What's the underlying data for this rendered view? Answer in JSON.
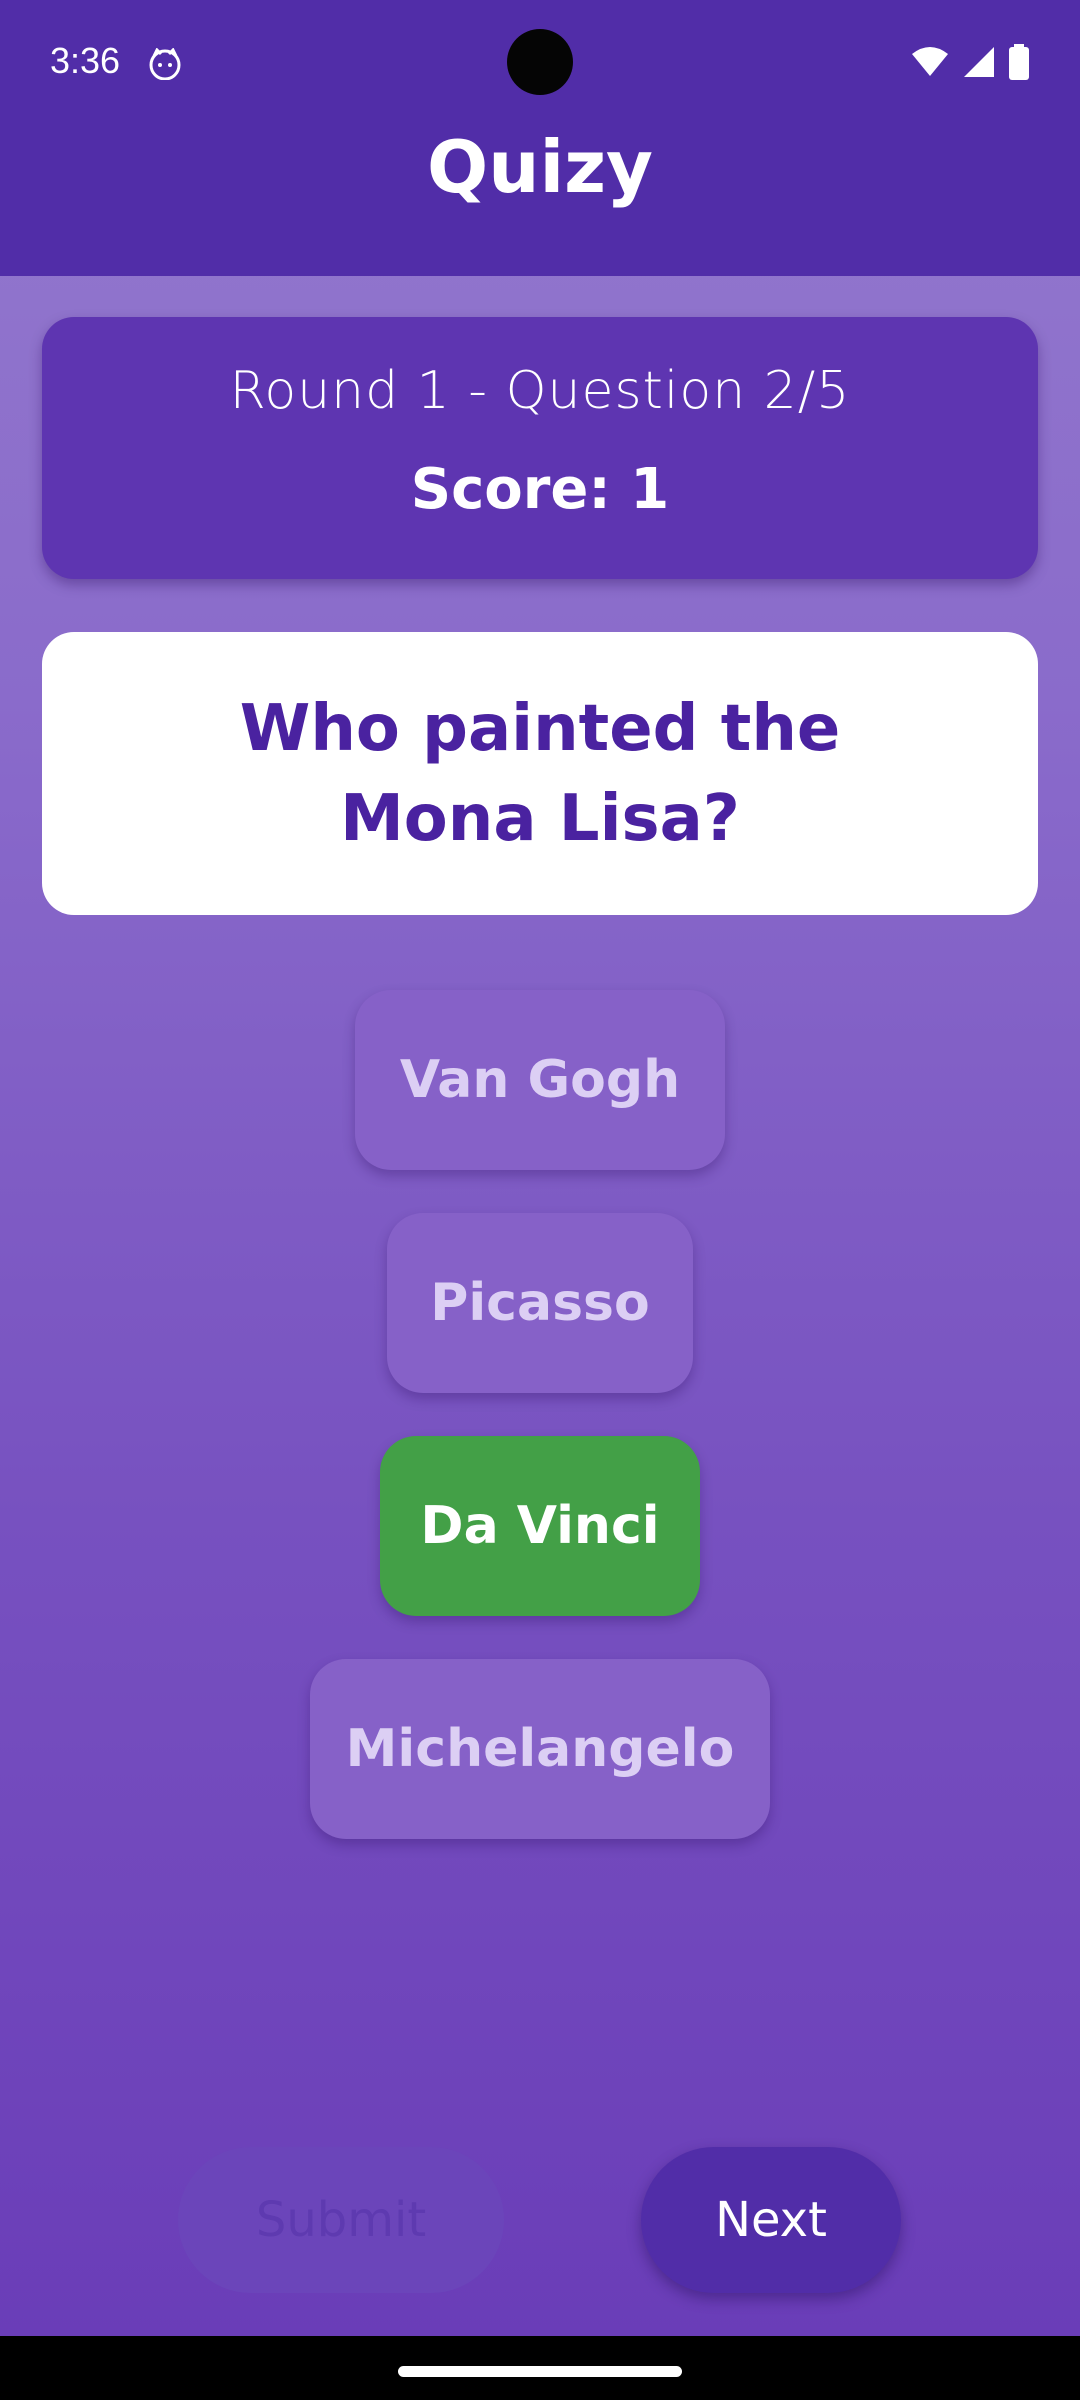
{
  "status_bar": {
    "time": "3:36",
    "notification_icon": "cat-face-icon",
    "icons": [
      "wifi-icon",
      "signal-icon",
      "battery-icon"
    ]
  },
  "app_bar": {
    "title": "Quizy"
  },
  "info": {
    "round_text": "Round 1 - Question 2/5",
    "score_text": "Score: 1"
  },
  "question": {
    "text": "Who painted the Mona Lisa?"
  },
  "answers": [
    {
      "label": "Van Gogh",
      "state": "idle"
    },
    {
      "label": "Picasso",
      "state": "idle"
    },
    {
      "label": "Da Vinci",
      "state": "selected-correct"
    },
    {
      "label": "Michelangelo",
      "state": "idle"
    }
  ],
  "actions": {
    "submit_label": "Submit",
    "submit_enabled": false,
    "next_label": "Next"
  },
  "colors": {
    "primary": "#512da8",
    "card": "#5e35b1",
    "correct": "#43a047",
    "question_text": "#4a22a0"
  }
}
